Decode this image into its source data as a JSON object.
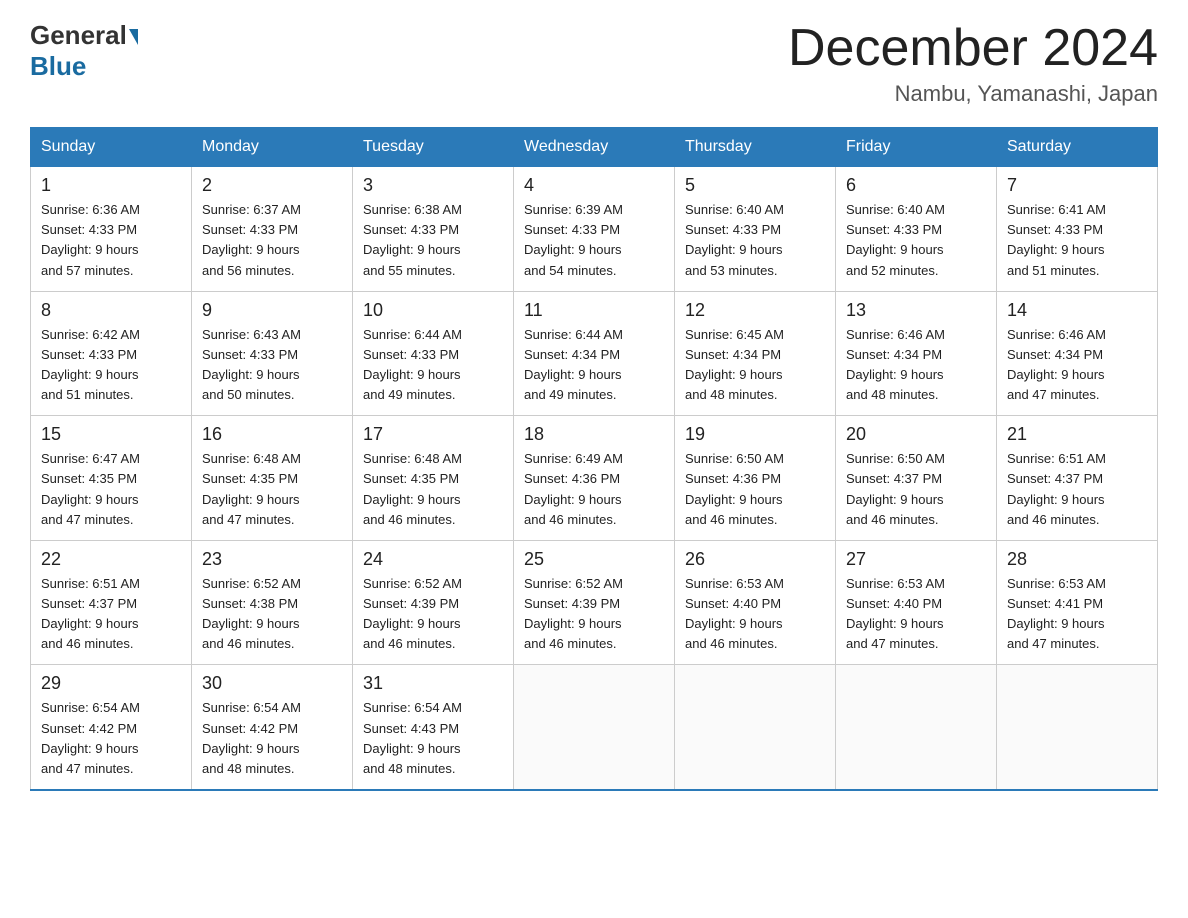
{
  "header": {
    "logo_general": "General",
    "logo_blue": "Blue",
    "month_title": "December 2024",
    "location": "Nambu, Yamanashi, Japan"
  },
  "days_of_week": [
    "Sunday",
    "Monday",
    "Tuesday",
    "Wednesday",
    "Thursday",
    "Friday",
    "Saturday"
  ],
  "weeks": [
    [
      {
        "day": "1",
        "sunrise": "6:36 AM",
        "sunset": "4:33 PM",
        "daylight": "9 hours and 57 minutes."
      },
      {
        "day": "2",
        "sunrise": "6:37 AM",
        "sunset": "4:33 PM",
        "daylight": "9 hours and 56 minutes."
      },
      {
        "day": "3",
        "sunrise": "6:38 AM",
        "sunset": "4:33 PM",
        "daylight": "9 hours and 55 minutes."
      },
      {
        "day": "4",
        "sunrise": "6:39 AM",
        "sunset": "4:33 PM",
        "daylight": "9 hours and 54 minutes."
      },
      {
        "day": "5",
        "sunrise": "6:40 AM",
        "sunset": "4:33 PM",
        "daylight": "9 hours and 53 minutes."
      },
      {
        "day": "6",
        "sunrise": "6:40 AM",
        "sunset": "4:33 PM",
        "daylight": "9 hours and 52 minutes."
      },
      {
        "day": "7",
        "sunrise": "6:41 AM",
        "sunset": "4:33 PM",
        "daylight": "9 hours and 51 minutes."
      }
    ],
    [
      {
        "day": "8",
        "sunrise": "6:42 AM",
        "sunset": "4:33 PM",
        "daylight": "9 hours and 51 minutes."
      },
      {
        "day": "9",
        "sunrise": "6:43 AM",
        "sunset": "4:33 PM",
        "daylight": "9 hours and 50 minutes."
      },
      {
        "day": "10",
        "sunrise": "6:44 AM",
        "sunset": "4:33 PM",
        "daylight": "9 hours and 49 minutes."
      },
      {
        "day": "11",
        "sunrise": "6:44 AM",
        "sunset": "4:34 PM",
        "daylight": "9 hours and 49 minutes."
      },
      {
        "day": "12",
        "sunrise": "6:45 AM",
        "sunset": "4:34 PM",
        "daylight": "9 hours and 48 minutes."
      },
      {
        "day": "13",
        "sunrise": "6:46 AM",
        "sunset": "4:34 PM",
        "daylight": "9 hours and 48 minutes."
      },
      {
        "day": "14",
        "sunrise": "6:46 AM",
        "sunset": "4:34 PM",
        "daylight": "9 hours and 47 minutes."
      }
    ],
    [
      {
        "day": "15",
        "sunrise": "6:47 AM",
        "sunset": "4:35 PM",
        "daylight": "9 hours and 47 minutes."
      },
      {
        "day": "16",
        "sunrise": "6:48 AM",
        "sunset": "4:35 PM",
        "daylight": "9 hours and 47 minutes."
      },
      {
        "day": "17",
        "sunrise": "6:48 AM",
        "sunset": "4:35 PM",
        "daylight": "9 hours and 46 minutes."
      },
      {
        "day": "18",
        "sunrise": "6:49 AM",
        "sunset": "4:36 PM",
        "daylight": "9 hours and 46 minutes."
      },
      {
        "day": "19",
        "sunrise": "6:50 AM",
        "sunset": "4:36 PM",
        "daylight": "9 hours and 46 minutes."
      },
      {
        "day": "20",
        "sunrise": "6:50 AM",
        "sunset": "4:37 PM",
        "daylight": "9 hours and 46 minutes."
      },
      {
        "day": "21",
        "sunrise": "6:51 AM",
        "sunset": "4:37 PM",
        "daylight": "9 hours and 46 minutes."
      }
    ],
    [
      {
        "day": "22",
        "sunrise": "6:51 AM",
        "sunset": "4:37 PM",
        "daylight": "9 hours and 46 minutes."
      },
      {
        "day": "23",
        "sunrise": "6:52 AM",
        "sunset": "4:38 PM",
        "daylight": "9 hours and 46 minutes."
      },
      {
        "day": "24",
        "sunrise": "6:52 AM",
        "sunset": "4:39 PM",
        "daylight": "9 hours and 46 minutes."
      },
      {
        "day": "25",
        "sunrise": "6:52 AM",
        "sunset": "4:39 PM",
        "daylight": "9 hours and 46 minutes."
      },
      {
        "day": "26",
        "sunrise": "6:53 AM",
        "sunset": "4:40 PM",
        "daylight": "9 hours and 46 minutes."
      },
      {
        "day": "27",
        "sunrise": "6:53 AM",
        "sunset": "4:40 PM",
        "daylight": "9 hours and 47 minutes."
      },
      {
        "day": "28",
        "sunrise": "6:53 AM",
        "sunset": "4:41 PM",
        "daylight": "9 hours and 47 minutes."
      }
    ],
    [
      {
        "day": "29",
        "sunrise": "6:54 AM",
        "sunset": "4:42 PM",
        "daylight": "9 hours and 47 minutes."
      },
      {
        "day": "30",
        "sunrise": "6:54 AM",
        "sunset": "4:42 PM",
        "daylight": "9 hours and 48 minutes."
      },
      {
        "day": "31",
        "sunrise": "6:54 AM",
        "sunset": "4:43 PM",
        "daylight": "9 hours and 48 minutes."
      },
      null,
      null,
      null,
      null
    ]
  ],
  "labels": {
    "sunrise": "Sunrise:",
    "sunset": "Sunset:",
    "daylight": "Daylight:"
  }
}
